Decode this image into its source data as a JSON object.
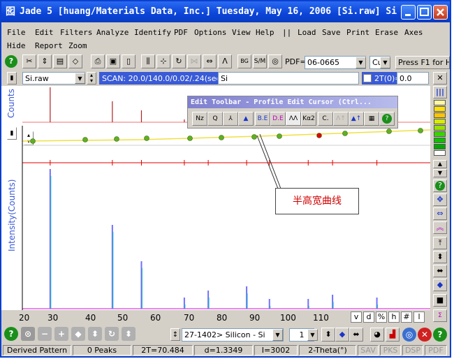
{
  "window": {
    "title": "Jade 5 [huang/Materials Data, Inc.] Tuesday, May 16, 2006 [Si.raw] Si",
    "app_icon_glyph": "囮"
  },
  "menu": {
    "row1": [
      "File",
      "Edit",
      "Filters",
      "Analyze",
      "Identify",
      "PDF",
      "Options",
      "View",
      "Help",
      "||",
      "Load",
      "Save",
      "Print",
      "Erase",
      "Axes"
    ],
    "row2": [
      "Hide",
      "Report",
      "Zoom"
    ]
  },
  "toolbar": {
    "pdf_label": "PDF=",
    "pdf_value": "06-0665",
    "target_value": "Cu",
    "help_hint": "Press F1 for He"
  },
  "scan_bar": {
    "file_value": "Si.raw",
    "scan_text": "SCAN: 20.0/140.0/0.02/.24(sec)",
    "sample_value": "Si",
    "two_theta_label": "2T(0)=",
    "two_theta_value": "0.0"
  },
  "plot": {
    "counts_label": "Counts",
    "intensity_label": "Intensity(Counts)",
    "x_ticks": [
      "20",
      "30",
      "40",
      "50",
      "60",
      "70",
      "80",
      "90",
      "100",
      "110"
    ],
    "x_range": [
      20,
      140
    ],
    "tab_buttons": [
      "v",
      "d",
      "%",
      "h",
      "#",
      "l"
    ]
  },
  "edit_toolbar": {
    "title": "Edit Toolbar - Profile Edit Cursor (Ctrl...",
    "buttons": [
      "Nz",
      "Q",
      "⅄",
      "▲",
      "B.E",
      "D.E",
      "ᐱᐱ",
      "Kα2",
      "C.",
      "ᐱ↑",
      "▲↑",
      "▦",
      "?"
    ]
  },
  "annotation": {
    "callout_text": "半高宽曲线"
  },
  "bottom_toolbar": {
    "phase_value": "27-1402> Silicon - Si",
    "index_value": "1"
  },
  "status": {
    "pattern": "Derived Pattern",
    "peaks": "0 Peaks",
    "two_theta": "2T=70.484",
    "d_value": "d=1.3349",
    "intensity": "I=3002",
    "axis_mode": "2-Theta(°)",
    "flags": [
      "SAV",
      "PKS",
      "DSP",
      "PDF"
    ]
  },
  "colors": {
    "title_bar": "#0b44d8",
    "trace": "#e00000",
    "bg_curve": "#f0e040",
    "peak_stick": "#7070ff",
    "callout_text": "#d00000"
  }
}
